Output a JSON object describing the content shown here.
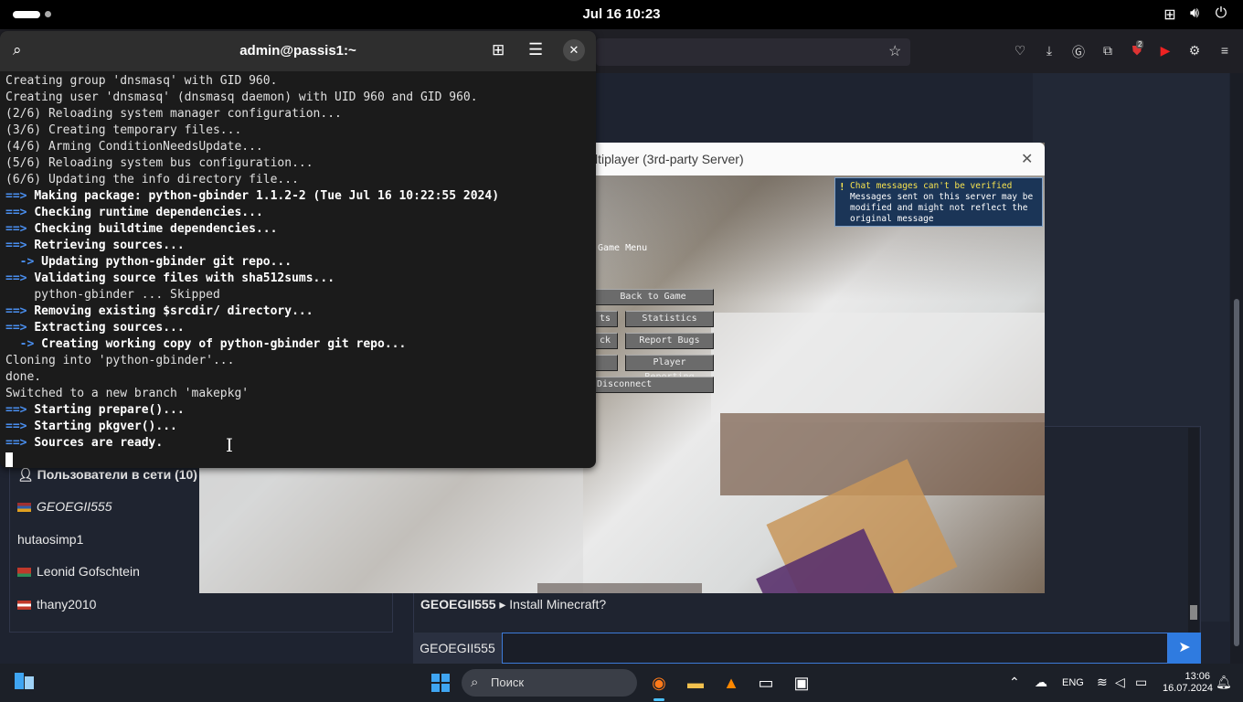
{
  "topbar": {
    "clock": "Jul 16  10:23"
  },
  "terminal": {
    "title": "admin@passis1:~",
    "lines": [
      {
        "arrow": "",
        "text": "Creating group 'dnsmasq' with GID 960.",
        "bold": false
      },
      {
        "arrow": "",
        "text": "Creating user 'dnsmasq' (dnsmasq daemon) with UID 960 and GID 960.",
        "bold": false
      },
      {
        "arrow": "",
        "text": "(2/6) Reloading system manager configuration...",
        "bold": false
      },
      {
        "arrow": "",
        "text": "(3/6) Creating temporary files...",
        "bold": false
      },
      {
        "arrow": "",
        "text": "(4/6) Arming ConditionNeedsUpdate...",
        "bold": false
      },
      {
        "arrow": "",
        "text": "(5/6) Reloading system bus configuration...",
        "bold": false
      },
      {
        "arrow": "",
        "text": "(6/6) Updating the info directory file...",
        "bold": false
      },
      {
        "arrow": "==>",
        "text": "Making package: python-gbinder 1.1.2-2 (Tue Jul 16 10:22:55 2024)",
        "bold": true
      },
      {
        "arrow": "==>",
        "text": "Checking runtime dependencies...",
        "bold": true
      },
      {
        "arrow": "==>",
        "text": "Checking buildtime dependencies...",
        "bold": true
      },
      {
        "arrow": "==>",
        "text": "Retrieving sources...",
        "bold": true
      },
      {
        "arrow": "  ->",
        "text": "Updating python-gbinder git repo...",
        "bold": true
      },
      {
        "arrow": "==>",
        "text": "Validating source files with sha512sums...",
        "bold": true
      },
      {
        "arrow": "    ",
        "text": "python-gbinder ... Skipped",
        "bold": false
      },
      {
        "arrow": "==>",
        "text": "Removing existing $srcdir/ directory...",
        "bold": true
      },
      {
        "arrow": "==>",
        "text": "Extracting sources...",
        "bold": true
      },
      {
        "arrow": "  ->",
        "text": "Creating working copy of python-gbinder git repo...",
        "bold": true
      },
      {
        "arrow": "",
        "text": "Cloning into 'python-gbinder'...",
        "bold": false
      },
      {
        "arrow": "",
        "text": "done.",
        "bold": false
      },
      {
        "arrow": "",
        "text": "Switched to a new branch 'makepkg'",
        "bold": false
      },
      {
        "arrow": "==>",
        "text": "Starting prepare()...",
        "bold": true
      },
      {
        "arrow": "==>",
        "text": "Starting pkgver()...",
        "bold": true
      },
      {
        "arrow": "==>",
        "text": "Sources are ready.",
        "bold": true
      }
    ]
  },
  "minecraft": {
    "title": "ltiplayer (3rd-party Server)",
    "menu_label": "Game Menu",
    "buttons": {
      "back": "Back to Game",
      "advancements": "ts",
      "statistics": "Statistics",
      "feedback": "ck",
      "report_bugs": "Report Bugs",
      "blank": "",
      "player_reporting": "Player Reporting",
      "disconnect": "Disconnect"
    },
    "warning_title": "Chat messages can't be verified",
    "warning_body": "Messages sent on this server may be modified and might not reflect the original message"
  },
  "users": {
    "header": "Пользователи в сети (10)",
    "items": [
      {
        "name": "GEOEGII555",
        "italic": true,
        "flag": [
          "#a03030",
          "#e0a020",
          "#2f5fa8"
        ]
      },
      {
        "name": "hutaosimp1",
        "italic": false,
        "flag": null
      },
      {
        "name": "Leonid Gofschtein",
        "italic": false,
        "flag": [
          "#c0392b",
          "#c0392b",
          "#2e8b57"
        ]
      },
      {
        "name": "thany2010",
        "italic": false,
        "flag": [
          "#c0392b",
          "#ffffff",
          "#c0392b"
        ]
      }
    ]
  },
  "chat": {
    "message_author": "GEOEGII555",
    "message_separator": "▸",
    "message_text": "Install Minecraft?",
    "input_user": "GEOEGII555",
    "input_value": ""
  },
  "taskbar": {
    "search_placeholder": "Поиск",
    "language": "ENG",
    "time": "13:06",
    "date": "16.07.2024"
  },
  "browser": {
    "notification_badge": "2"
  }
}
